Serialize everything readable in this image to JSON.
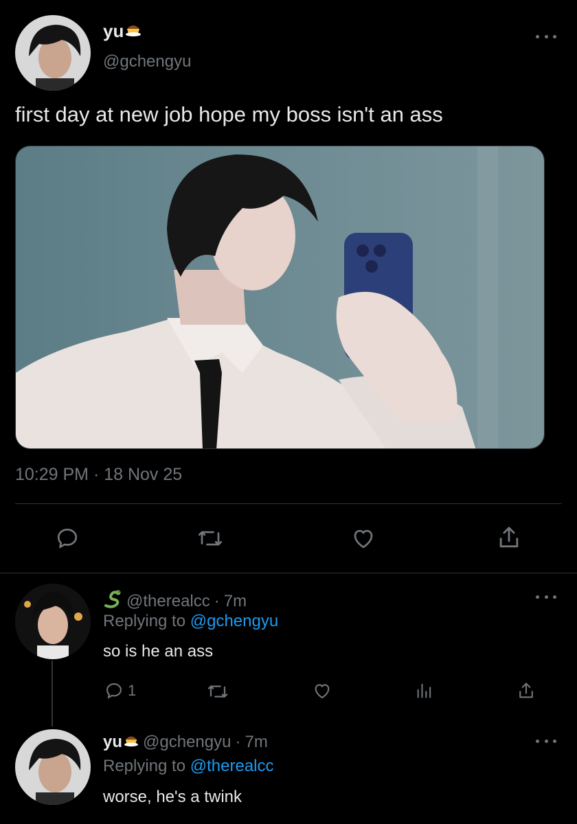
{
  "main_tweet": {
    "display_name": "yu",
    "name_emoji_icon": "pudding-icon",
    "handle": "@gchengyu",
    "text": "first day at new job hope my boss isn't an ass",
    "image": "selfie-photo",
    "timestamp": "10:29 PM · 18 Nov 25",
    "actions": [
      "reply-icon",
      "retweet-icon",
      "like-icon",
      "share-icon"
    ]
  },
  "reply_1": {
    "badge_icon": "snake-icon",
    "handle": "@therealcc",
    "time": "7m",
    "replying_prefix": "Replying to",
    "replying_to": "@gchengyu",
    "text": "so is he an ass",
    "reply_count": "1"
  },
  "reply_2": {
    "display_name": "yu",
    "name_emoji_icon": "pudding-icon",
    "handle": "@gchengyu",
    "time": "7m",
    "replying_prefix": "Replying to",
    "replying_to": "@therealcc",
    "text": "worse, he's a twink"
  },
  "colors": {
    "background": "#000000",
    "text": "#e7e9ea",
    "muted": "#71767b",
    "link": "#1d9bf0",
    "divider": "#2f3336"
  }
}
